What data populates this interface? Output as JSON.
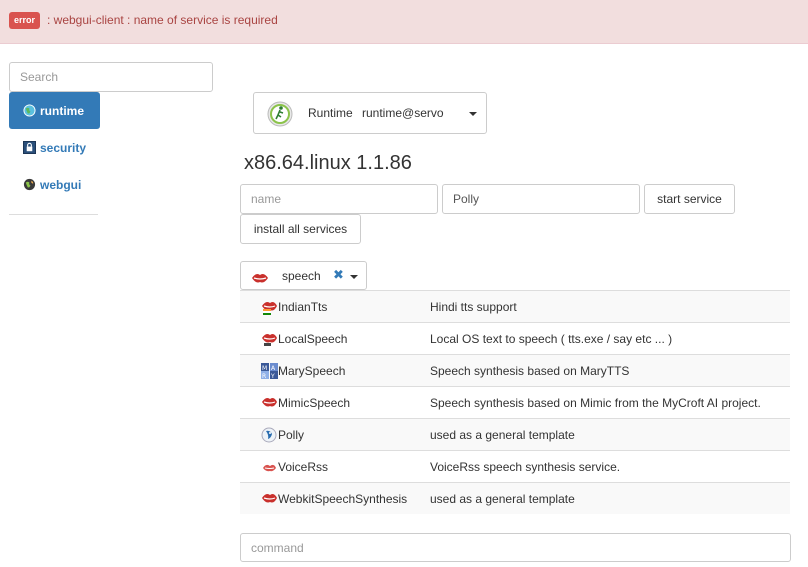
{
  "alert": {
    "badge": "error",
    "message": ": webgui-client : name of service is required"
  },
  "search": {
    "placeholder": "Search"
  },
  "nav": {
    "items": [
      {
        "label": "runtime",
        "icon": "globe-icon",
        "active": true
      },
      {
        "label": "security",
        "icon": "lock-icon",
        "active": false
      },
      {
        "label": "webgui",
        "icon": "globe-icon",
        "active": false
      }
    ]
  },
  "runtime_selector": {
    "label": "Runtime",
    "value": "runtime@servo",
    "icon": "runtime-runner-icon"
  },
  "version": "x86.64.linux 1.1.86",
  "service_form": {
    "name_placeholder": "name",
    "type_value": "Polly",
    "start_label": "start service",
    "install_label": "install all services"
  },
  "category_filter": {
    "label": "speech",
    "clear_glyph": "✖"
  },
  "services": [
    {
      "name": "IndianTts",
      "description": "Hindi tts support",
      "icon": "lips-india-flag-icon"
    },
    {
      "name": "LocalSpeech",
      "description": "Local OS text to speech ( tts.exe / say etc ... )",
      "icon": "lips-icon"
    },
    {
      "name": "MarySpeech",
      "description": "Speech synthesis based on MaryTTS",
      "icon": "mary-logo-icon"
    },
    {
      "name": "MimicSpeech",
      "description": "Speech synthesis based on Mimic from the MyCroft AI project.",
      "icon": "lips-icon"
    },
    {
      "name": "Polly",
      "description": "used as a general template",
      "icon": "polly-icon"
    },
    {
      "name": "VoiceRss",
      "description": "VoiceRss speech synthesis service.",
      "icon": "small-lips-icon"
    },
    {
      "name": "WebkitSpeechSynthesis",
      "description": "used as a general template",
      "icon": "lips-icon"
    }
  ],
  "command": {
    "placeholder": "command"
  },
  "colors": {
    "primary": "#337ab7",
    "alert_bg": "#f2dede",
    "alert_text": "#a94442",
    "badge": "#d9534f",
    "lips": "#c9302c"
  }
}
